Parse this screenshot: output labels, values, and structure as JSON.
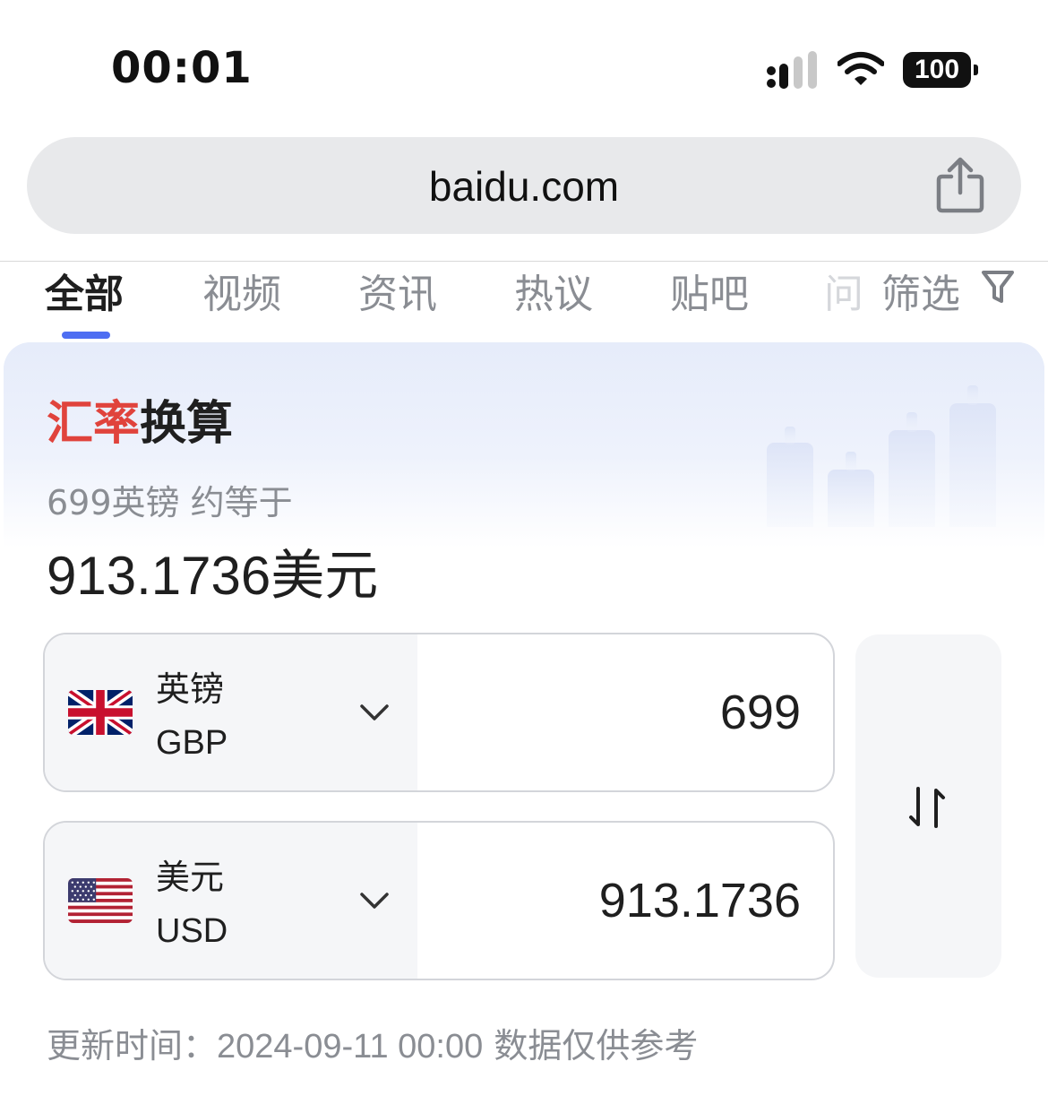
{
  "status_bar": {
    "time": "00:01",
    "battery": "100"
  },
  "browser": {
    "url": "baidu.com"
  },
  "tabs": [
    {
      "label": "全部",
      "active": true
    },
    {
      "label": "视频",
      "active": false
    },
    {
      "label": "资讯",
      "active": false
    },
    {
      "label": "热议",
      "active": false
    },
    {
      "label": "贴吧",
      "active": false
    }
  ],
  "tab_partial": "问",
  "filter_label": "筛选",
  "card": {
    "title_red": "汇率",
    "title_rest": "换算",
    "subtitle": "699英镑 约等于",
    "result": "913.1736美元"
  },
  "converter": {
    "from": {
      "name": "英镑",
      "code": "GBP",
      "amount": "699"
    },
    "to": {
      "name": "美元",
      "code": "USD",
      "amount": "913.1736"
    }
  },
  "footer": {
    "label": "更新时间：",
    "datetime": "2024-09-11 00:00",
    "note": "数据仅供参考"
  },
  "colors": {
    "accent": "#4e6ef2",
    "title_red": "#e0433c"
  }
}
